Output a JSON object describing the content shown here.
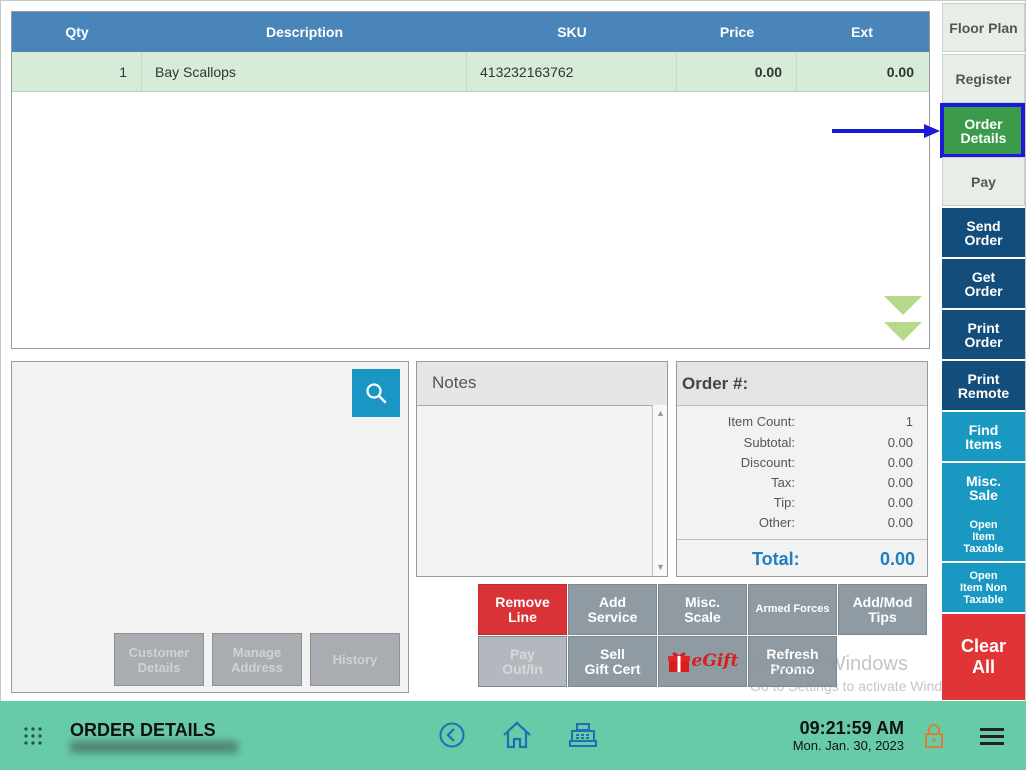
{
  "order_table": {
    "headers": {
      "qty": "Qty",
      "description": "Description",
      "sku": "SKU",
      "price": "Price",
      "ext": "Ext"
    },
    "rows": [
      {
        "qty": "1",
        "description": "Bay Scallops",
        "sku": "413232163762",
        "price": "0.00",
        "ext": "0.00"
      }
    ],
    "row_color": "#d6ecd8",
    "header_color": "#4a85b9"
  },
  "customer": {
    "buttons": {
      "customer_details": "Customer\nDetails",
      "manage_address": "Manage\nAddress",
      "history": "History"
    }
  },
  "notes": {
    "title": "Notes"
  },
  "order_summary": {
    "title": "Order #:",
    "lines": [
      {
        "label": "Item Count:",
        "value": "1"
      },
      {
        "label": "Subtotal:",
        "value": "0.00"
      },
      {
        "label": "Discount:",
        "value": "0.00"
      },
      {
        "label": "Tax:",
        "value": "0.00"
      },
      {
        "label": "Tip:",
        "value": "0.00"
      },
      {
        "label": "Other:",
        "value": "0.00"
      }
    ],
    "total_label": "Total:",
    "total_value": "0.00"
  },
  "actions": {
    "remove_line": "Remove\nLine",
    "add_service": "Add\nService",
    "misc_scale": "Misc.\nScale",
    "armed_forces": "Armed Forces",
    "add_mod_tips": "Add/Mod\nTips",
    "pay_out_in": "Pay\nOut/In",
    "sell_gift_cert": "Sell\nGift Cert",
    "egift": "eGift",
    "refresh_promo": "Refresh\nPromo"
  },
  "watermark": {
    "line1": "Activate Windows",
    "line2": "Go to Settings to activate Windows."
  },
  "right_nav": {
    "floor_plan": "Floor Plan",
    "register": "Register",
    "order_details": "Order\nDetails",
    "pay": "Pay",
    "send_order": "Send\nOrder",
    "get_order": "Get\nOrder",
    "print_order": "Print\nOrder",
    "print_remote": "Print\nRemote",
    "find_items": "Find\nItems",
    "misc_sale": "Misc.\nSale",
    "open_item_taxable": "Open\nItem\nTaxable",
    "open_item_non_taxable": "Open\nItem Non\nTaxable",
    "clear_all": "Clear\nAll"
  },
  "footer": {
    "title": "ORDER DETAILS",
    "time": "09:21:59 AM",
    "date": "Mon. Jan. 30, 2023",
    "icons": [
      "grid-icon",
      "back-icon",
      "home-icon",
      "register-icon",
      "lock-icon",
      "menu-icon"
    ]
  },
  "colors": {
    "accent_green": "#3b9b4a",
    "dark_blue": "#134d7c",
    "teal": "#1998c2",
    "red": "#e03437",
    "footer": "#68cba7",
    "highlight": "#1a1ad8"
  }
}
